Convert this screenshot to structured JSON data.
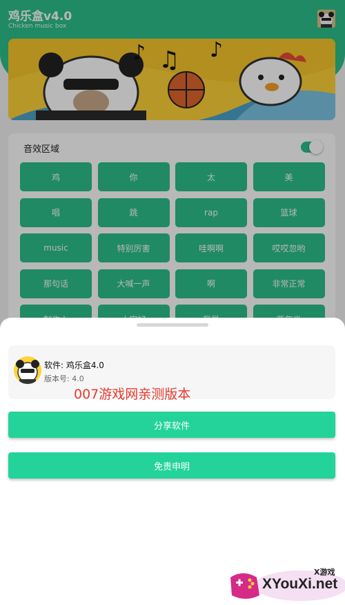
{
  "app": {
    "title": "鸡乐盒v4.0",
    "subtitle": "Chicken music box",
    "accent_color": "#2bbf8b"
  },
  "sound_section": {
    "title": "音效区域",
    "toggle_on": true,
    "buttons": [
      "鸡",
      "你",
      "太",
      "美",
      "唱",
      "跳",
      "rap",
      "篮球",
      "music",
      "特别厉害",
      "哇啊啊",
      "哎哎忽哟",
      "那句话",
      "大喊一声",
      "啊",
      "非常正常",
      "制作人",
      "大家好",
      "我是",
      "两年半"
    ]
  },
  "sheet": {
    "software_name": "软件: 鸡乐盒4.0",
    "version": "版本号: 4.0",
    "overlay_text": "007游戏网亲测版本",
    "share_button": "分享软件",
    "disclaimer_button": "免责申明",
    "button_color": "#23d39a"
  },
  "watermark": {
    "site": "XYouXi.net",
    "label": "X游戏"
  }
}
